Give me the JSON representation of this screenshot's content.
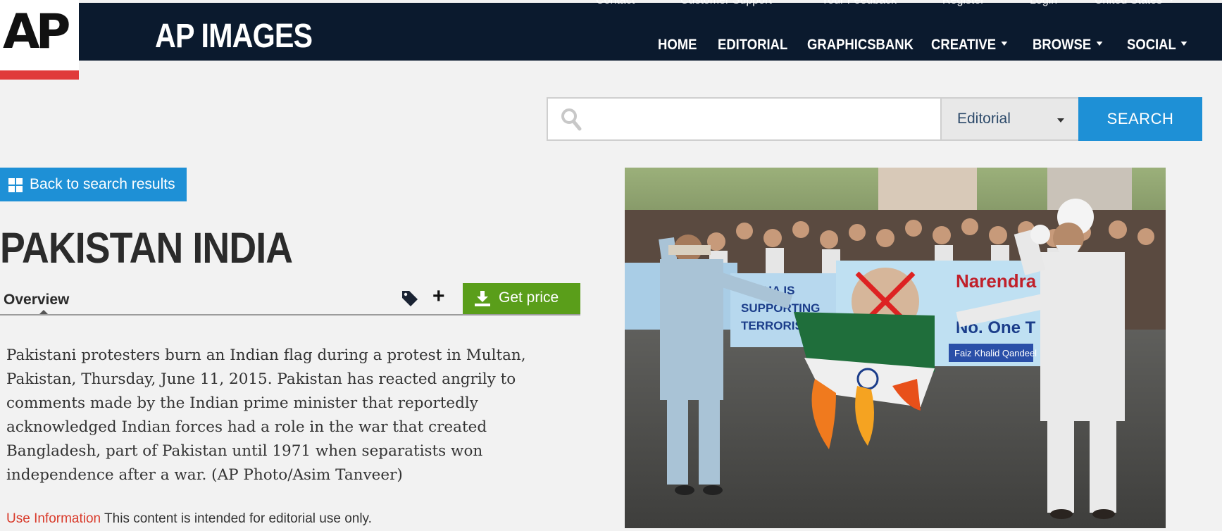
{
  "header": {
    "logo_text": "AP",
    "brand": "AP IMAGES",
    "top_links": [
      "Contact",
      "Customer Support",
      "Your Feedback",
      "Register",
      "Login",
      "United States"
    ],
    "nav": [
      "HOME",
      "EDITORIAL",
      "GRAPHICSBANK",
      "CREATIVE",
      "BROWSE",
      "SOCIAL"
    ]
  },
  "search": {
    "input_value": "",
    "select_value": "Editorial",
    "button_label": "SEARCH"
  },
  "back": {
    "label": "Back to search results"
  },
  "title": "PAKISTAN INDIA",
  "tabs": {
    "overview": "Overview",
    "get_price": "Get price"
  },
  "caption": "Pakistani protesters burn an Indian flag during a protest in Multan, Pakistan, Thursday, June 11, 2015. Pakistan has reacted angrily to comments made by the Indian prime minister that reportedly acknowledged Indian forces had a role in the war that created Bangladesh, part of Pakistan until 1971 when separatists won independence after a war. (AP Photo/Asim Tanveer)",
  "use_info": {
    "link": "Use Information",
    "text": " This content is intended for editorial use only."
  },
  "photo": {
    "banner_left": "INDIA IS SUPPORTING TERRORISM",
    "banner_right": "Narendra ... No. One T...",
    "banner_footer": "Faiz Khalid Qandeel"
  },
  "colors": {
    "header_bg": "#0b1a2e",
    "accent_blue": "#1e90d6",
    "price_green": "#5a9e1a",
    "logo_red": "#e03a3a"
  }
}
